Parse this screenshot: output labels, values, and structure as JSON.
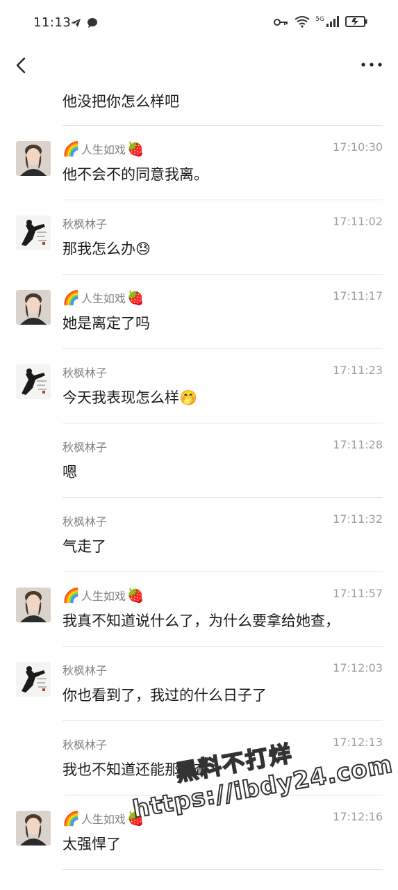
{
  "status_bar": {
    "time": "11:13",
    "network": "5G"
  },
  "first_message_text": "他没把你怎么样吧",
  "messages": [
    {
      "sender": "人生如戏",
      "sender_prefix_icon": "rainbow-icon",
      "sender_suffix_icon": "strawberry-icon",
      "time": "17:10:30",
      "text": "他不会不的同意我离。",
      "avatar": "female-avatar"
    },
    {
      "sender": "秋枫林子",
      "time": "17:11:02",
      "text": "那我怎么办😓",
      "avatar": "male-avatar"
    },
    {
      "sender": "人生如戏",
      "sender_prefix_icon": "rainbow-icon",
      "sender_suffix_icon": "strawberry-icon",
      "time": "17:11:17",
      "text": "她是离定了吗",
      "avatar": "female-avatar"
    },
    {
      "sender": "秋枫林子",
      "time": "17:11:23",
      "text": "今天我表现怎么样🤭",
      "avatar": "male-avatar"
    },
    {
      "sender": "秋枫林子",
      "time": "17:11:28",
      "text": "嗯",
      "avatar": ""
    },
    {
      "sender": "秋枫林子",
      "time": "17:11:32",
      "text": "气走了",
      "avatar": ""
    },
    {
      "sender": "人生如戏",
      "sender_prefix_icon": "rainbow-icon",
      "sender_suffix_icon": "strawberry-icon",
      "time": "17:11:57",
      "text": "我真不知道说什么了，为什么要拿给她查，",
      "avatar": "female-avatar"
    },
    {
      "sender": "秋枫林子",
      "time": "17:12:03",
      "text": "你也看到了，我过的什么日子了",
      "avatar": "male-avatar"
    },
    {
      "sender": "秋枫林子",
      "time": "17:12:13",
      "text": "我也不知道还能那样查",
      "avatar": ""
    },
    {
      "sender": "人生如戏",
      "sender_prefix_icon": "rainbow-icon",
      "sender_suffix_icon": "strawberry-icon",
      "time": "17:12:16",
      "text": "太强悍了",
      "avatar": "female-avatar"
    }
  ],
  "watermark": {
    "line1": "黑料不打烊",
    "line2": "https://ibdy24.com"
  },
  "colors": {
    "background": "#ffffff",
    "divider": "#e6e6e6",
    "meta_text": "#7f7f7f"
  }
}
